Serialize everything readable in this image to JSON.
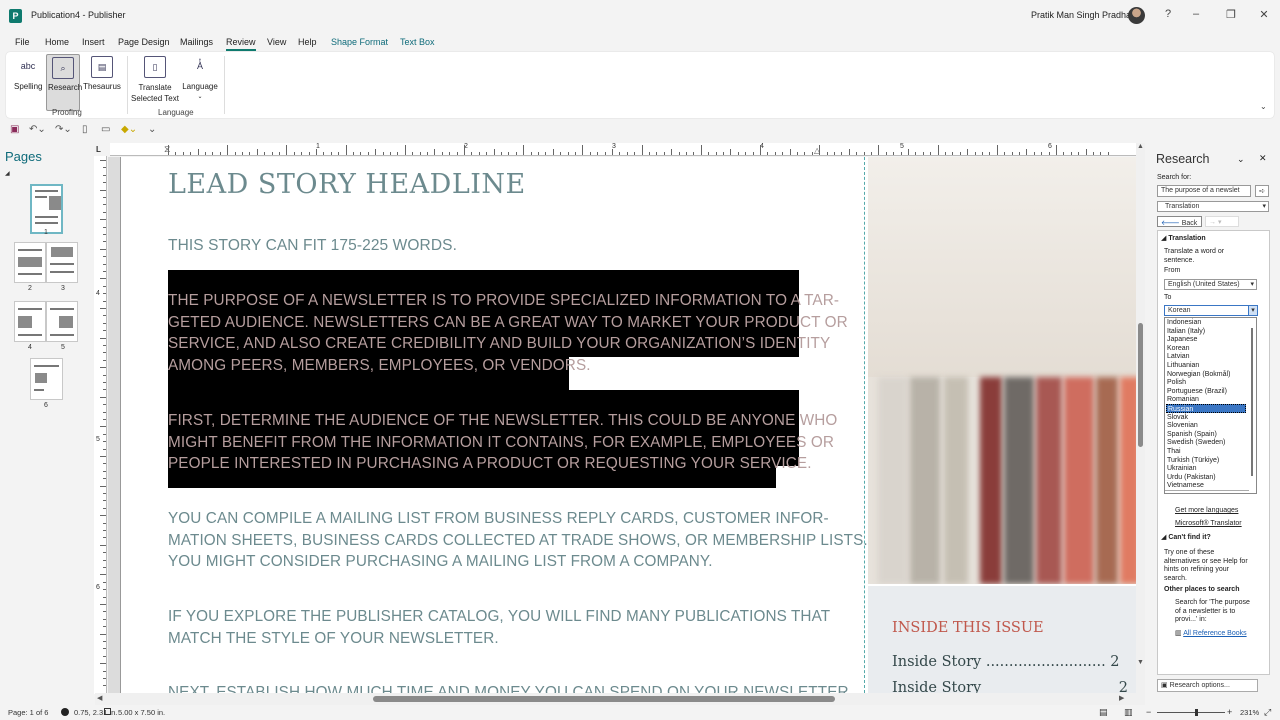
{
  "title_bar": {
    "doc_title": "Publication4 - Publisher",
    "user": "Pratik Man Singh Pradhan",
    "help": "?",
    "minimize": "–",
    "restore": "❐",
    "close": "✕"
  },
  "menu": {
    "items": [
      "File",
      "Home",
      "Insert",
      "Page Design",
      "Mailings",
      "Review",
      "View",
      "Help",
      "Shape Format",
      "Text Box"
    ],
    "active": "Review"
  },
  "ribbon": {
    "spelling": "Spelling",
    "research": "Research",
    "thesaurus": "Thesaurus",
    "translate_1": "Translate",
    "translate_2": "Selected Text",
    "language": "Language",
    "group_proofing": "Proofing",
    "group_language": "Language"
  },
  "pages_pane": {
    "title": "Pages",
    "numbers": [
      "1",
      "2",
      "3",
      "4",
      "5",
      "6"
    ]
  },
  "rulers": {
    "h_marks": [
      "1",
      "2",
      "3",
      "4",
      "5",
      "6",
      "7"
    ],
    "v_marks": [
      "4",
      "5",
      "6"
    ],
    "corner": "L"
  },
  "document": {
    "headline": "LEAD STORY HEADLINE",
    "subhead": "THIS STORY CAN FIT 175-225 WORDS.",
    "para1": [
      "THE PURPOSE OF A NEWSLETTER IS TO PROVIDE SPECIALIZED INFORMATION TO A TAR-",
      "GETED AUDIENCE. NEWSLETTERS CAN BE A GREAT WAY TO MARKET YOUR PRODUCT OR",
      "SERVICE, AND ALSO CREATE CREDIBILITY AND BUILD YOUR ORGANIZATION’S IDENTITY",
      "AMONG PEERS, MEMBERS, EMPLOYEES, OR VENDORS."
    ],
    "para2": [
      "FIRST, DETERMINE THE AUDIENCE OF THE NEWSLETTER. THIS COULD BE ANYONE WHO",
      "MIGHT BENEFIT FROM THE INFORMATION IT CONTAINS, FOR EXAMPLE, EMPLOYEES OR",
      "PEOPLE INTERESTED IN PURCHASING A PRODUCT OR REQUESTING YOUR SERVICE."
    ],
    "para3": [
      "YOU CAN COMPILE A MAILING LIST FROM BUSINESS REPLY CARDS, CUSTOMER INFOR-",
      "MATION SHEETS, BUSINESS CARDS COLLECTED AT TRADE SHOWS, OR MEMBERSHIP LISTS.",
      "YOU MIGHT CONSIDER PURCHASING A MAILING LIST FROM A COMPANY."
    ],
    "para4": [
      "IF YOU EXPLORE THE PUBLISHER CATALOG, YOU WILL FIND MANY PUBLICATIONS THAT",
      "MATCH THE STYLE OF YOUR NEWSLETTER."
    ],
    "para5": "NEXT, ESTABLISH HOW MUCH TIME AND MONEY YOU CAN SPEND ON YOUR NEWSLETTER.",
    "inside_title": "INSIDE THIS ISSUE",
    "toc": [
      {
        "label": "Inside Story ..........................",
        "page": "2"
      },
      {
        "label": "Inside Story",
        "page": "2"
      }
    ]
  },
  "research": {
    "title": "Research",
    "search_for_label": "Search for:",
    "search_value": "The purpose of a newslet",
    "service": "Translation",
    "back": "Back",
    "section_translation": "Translation",
    "translate_hint": "Translate a word or sentence.",
    "from_label": "From",
    "from_value": "English (United States)",
    "to_label": "To",
    "to_value": "Korean",
    "languages": [
      "Indonesian",
      "Italian (Italy)",
      "Japanese",
      "Korean",
      "Latvian",
      "Lithuanian",
      "Norwegian (Bokmål)",
      "Polish",
      "Portuguese (Brazil)",
      "Romanian",
      "Russian",
      "Slovak",
      "Slovenian",
      "Spanish (Spain)",
      "Swedish (Sweden)",
      "Thai",
      "Turkish (Türkiye)",
      "Ukrainian",
      "Urdu (Pakistan)",
      "Vietnamese"
    ],
    "highlighted": "Russian",
    "get_more": "Get more languages",
    "ms_translator": "Microsoft® Translator",
    "cant_find": "Can't find it?",
    "cant_find_text": "Try one of these alternatives or see Help for hints on refining your search.",
    "other_places": "Other places to search",
    "search_for_quote": "Search for 'The purpose of a newsletter is to provi...' in:",
    "all_ref_books": "All Reference Books",
    "options": "Research options..."
  },
  "status": {
    "page": "Page: 1 of 6",
    "position": "0.75, 2.31 in.",
    "size": "5.00 x 7.50 in.",
    "zoom": "231%"
  }
}
